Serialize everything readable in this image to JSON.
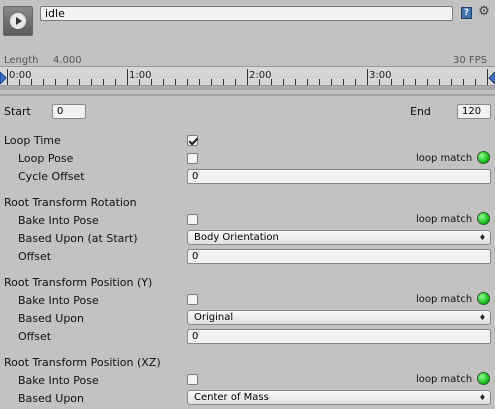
{
  "header": {
    "clip_name": "idle"
  },
  "timeline": {
    "length_label": "Length",
    "length_value": "4.000",
    "fps": "30 FPS",
    "ticks": [
      "0:00",
      "1:00",
      "2:00",
      "3:00"
    ]
  },
  "range": {
    "start_label": "Start",
    "start_value": "0",
    "end_label": "End",
    "end_value": "120"
  },
  "loop": {
    "loop_time_label": "Loop Time",
    "loop_time_checked": true,
    "loop_pose_label": "Loop Pose",
    "loop_pose_checked": false,
    "cycle_offset_label": "Cycle Offset",
    "cycle_offset_value": "0",
    "loop_match_label": "loop match"
  },
  "root_rotation": {
    "header": "Root Transform Rotation",
    "bake_label": "Bake Into Pose",
    "bake_checked": false,
    "based_upon_label": "Based Upon (at Start)",
    "based_upon_value": "Body Orientation",
    "offset_label": "Offset",
    "offset_value": "0",
    "loop_match_label": "loop match"
  },
  "root_position_y": {
    "header": "Root Transform Position (Y)",
    "bake_label": "Bake Into Pose",
    "bake_checked": false,
    "based_upon_label": "Based Upon",
    "based_upon_value": "Original",
    "offset_label": "Offset",
    "offset_value": "0",
    "loop_match_label": "loop match"
  },
  "root_position_xz": {
    "header": "Root Transform Position (XZ)",
    "bake_label": "Bake Into Pose",
    "bake_checked": false,
    "based_upon_label": "Based Upon",
    "based_upon_value": "Center of Mass",
    "loop_match_label": "loop match"
  },
  "icons": {
    "play": "play-icon",
    "help": "help-icon",
    "settings": "gear-icon",
    "status": "green-led-icon"
  },
  "colors": {
    "loop_match_led": "#19c41f",
    "panel_bg": "#c2c2c2"
  }
}
